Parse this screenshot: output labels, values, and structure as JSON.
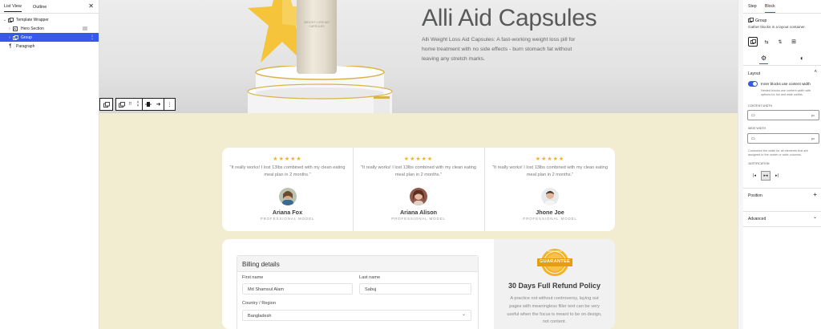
{
  "list_view": {
    "tabs": [
      "List View",
      "Outline"
    ],
    "items": [
      {
        "label": "Template Wrapper",
        "level": 0,
        "expanded": true
      },
      {
        "label": "Hero Section",
        "level": 1,
        "expanded": false
      },
      {
        "label": "Group",
        "level": 1,
        "expanded": false,
        "selected": true
      },
      {
        "label": "Paragraph",
        "level": 0,
        "expanded": false
      }
    ]
  },
  "hero": {
    "title": "Alli Aid Capsules",
    "description": "Alli Weight Loss Aid Capsules: A fast-working weight loss pill for home treatment with no side effects - burn stomach fat without leaving any stretch marks.",
    "bottle_label": "WEIGHT LOSS AID CAPSULES"
  },
  "testimonials": [
    {
      "rating": "★★★★★",
      "quote": "\"It really works! I lost 13lbs combined with my clean eating meal plan in 2 months.\"",
      "name": "Ariana Fox",
      "role": "PROFESSIONAL MODEL"
    },
    {
      "rating": "★★★★★",
      "quote": "\"It really works! I lost 13lbs combined with my clean eating meal plan in 2 months.\"",
      "name": "Ariana Alison",
      "role": "PROFESSIONAL MODEL"
    },
    {
      "rating": "★★★★★",
      "quote": "\"It really works! I lost 13lbs combined with my clean eating meal plan in 2 months.\"",
      "name": "Jhone Joe",
      "role": "PROFESSIONAL MODEL"
    }
  ],
  "billing": {
    "heading": "Billing details",
    "first_name_label": "First name",
    "first_name_value": "Md Shamsul Alam",
    "last_name_label": "Last name",
    "last_name_value": "Sabuj",
    "country_label": "Country / Region",
    "country_value": "Bangladesh"
  },
  "refund": {
    "badge_text": "GUARANTEE",
    "badge_ring_text": "MONEY BACK",
    "title": "30 Days Full Refund Policy",
    "text": "A practice not without controversy, laying out pages with meaningless filler text can be very useful when the focus is meant to be on design, not content."
  },
  "sidebar": {
    "tabs": [
      "Step",
      "Block"
    ],
    "block_name": "Group",
    "block_desc": "Gather blocks in a layout container.",
    "layout_title": "Layout",
    "toggle_label": "Inner blocks use content width",
    "toggle_help": "Nested blocks use content width with options for full and wide widths.",
    "content_width_label": "CONTENT WIDTH",
    "wide_width_label": "WIDE WIDTH",
    "unit": "px",
    "width_help": "Customize the width for all elements that are assigned to the center or wide columns.",
    "justification_label": "JUSTIFICATION",
    "position_label": "Position",
    "advanced_label": "Advanced"
  },
  "colors": {
    "accent": "#3858e9",
    "canvas": "#f2ecd1",
    "star": "#f1b51c"
  }
}
